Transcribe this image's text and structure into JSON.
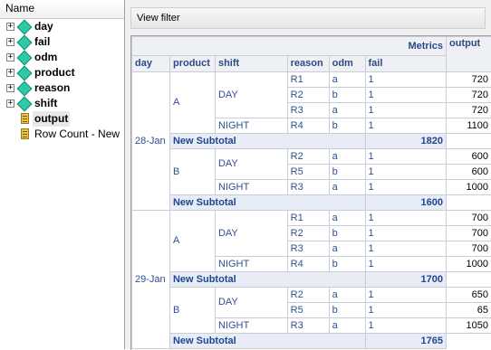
{
  "tree": {
    "header": "Name",
    "dimensions": [
      {
        "label": "day",
        "icon": "dimension-icon"
      },
      {
        "label": "fail",
        "icon": "dimension-icon"
      },
      {
        "label": "odm",
        "icon": "dimension-icon"
      },
      {
        "label": "product",
        "icon": "dimension-icon"
      },
      {
        "label": "reason",
        "icon": "dimension-icon"
      },
      {
        "label": "shift",
        "icon": "dimension-icon"
      }
    ],
    "measures": [
      {
        "label": "output",
        "icon": "measure-icon"
      },
      {
        "label": "Row Count - New",
        "icon": "measure-icon"
      }
    ]
  },
  "toolbar": {
    "view_filter": "View filter"
  },
  "grid": {
    "metrics_label": "Metrics",
    "metric_col": "output",
    "columns": [
      "day",
      "product",
      "shift",
      "reason",
      "odm",
      "fail"
    ],
    "subtotal_label": "New Subtotal",
    "days": [
      {
        "day": "28-Jan",
        "products": [
          {
            "product": "A",
            "shifts": [
              {
                "shift": "DAY",
                "rows": [
                  {
                    "reason": "R1",
                    "odm": "a",
                    "fail": "1",
                    "output": "720"
                  },
                  {
                    "reason": "R2",
                    "odm": "b",
                    "fail": "1",
                    "output": "720"
                  },
                  {
                    "reason": "R3",
                    "odm": "a",
                    "fail": "1",
                    "output": "720"
                  }
                ]
              },
              {
                "shift": "NIGHT",
                "rows": [
                  {
                    "reason": "R4",
                    "odm": "b",
                    "fail": "1",
                    "output": "1100"
                  }
                ]
              }
            ],
            "subtotal": "1820"
          },
          {
            "product": "B",
            "shifts": [
              {
                "shift": "DAY",
                "rows": [
                  {
                    "reason": "R2",
                    "odm": "a",
                    "fail": "1",
                    "output": "600"
                  },
                  {
                    "reason": "R5",
                    "odm": "b",
                    "fail": "1",
                    "output": "600"
                  }
                ]
              },
              {
                "shift": "NIGHT",
                "rows": [
                  {
                    "reason": "R3",
                    "odm": "a",
                    "fail": "1",
                    "output": "1000"
                  }
                ]
              }
            ],
            "subtotal": "1600"
          }
        ]
      },
      {
        "day": "29-Jan",
        "products": [
          {
            "product": "A",
            "shifts": [
              {
                "shift": "DAY",
                "rows": [
                  {
                    "reason": "R1",
                    "odm": "a",
                    "fail": "1",
                    "output": "700"
                  },
                  {
                    "reason": "R2",
                    "odm": "b",
                    "fail": "1",
                    "output": "700"
                  },
                  {
                    "reason": "R3",
                    "odm": "a",
                    "fail": "1",
                    "output": "700"
                  }
                ]
              },
              {
                "shift": "NIGHT",
                "rows": [
                  {
                    "reason": "R4",
                    "odm": "b",
                    "fail": "1",
                    "output": "1000"
                  }
                ]
              }
            ],
            "subtotal": "1700"
          },
          {
            "product": "B",
            "shifts": [
              {
                "shift": "DAY",
                "rows": [
                  {
                    "reason": "R2",
                    "odm": "a",
                    "fail": "1",
                    "output": "650"
                  },
                  {
                    "reason": "R5",
                    "odm": "b",
                    "fail": "1",
                    "output": "65"
                  }
                ]
              },
              {
                "shift": "NIGHT",
                "rows": [
                  {
                    "reason": "R3",
                    "odm": "a",
                    "fail": "1",
                    "output": "1050"
                  }
                ]
              }
            ],
            "subtotal": "1765"
          }
        ]
      }
    ]
  },
  "colors": {
    "dimension": "#2ec9a7",
    "measure": "#e9c24a",
    "header_text": "#2c4a8a",
    "subtotal_bg": "#e7ecf6"
  }
}
